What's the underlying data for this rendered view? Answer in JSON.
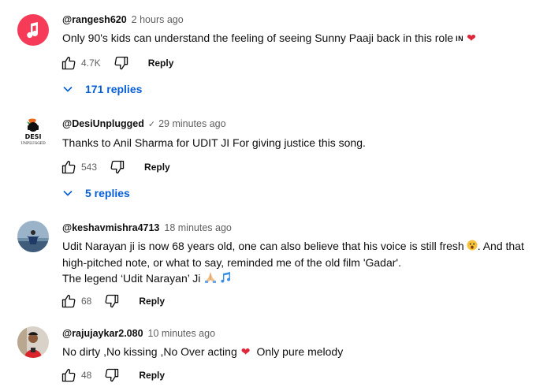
{
  "comments": [
    {
      "author": "@rangesh620",
      "time": "2 hours ago",
      "lines": [
        "Only 90's kids can understand the feeling of seeing Sunny Paaji back in this role"
      ],
      "country": "IN",
      "likes": "4.7K",
      "reply_label": "Reply",
      "replies_label": "171 replies",
      "avatar_icon": "music-note-icon",
      "avatar_color": "#f53b57"
    },
    {
      "author": "@DesiUnplugged",
      "verified": "✓",
      "time": "29 minutes ago",
      "lines": [
        "Thanks to Anil Sharma for UDIT JI For giving justice this song."
      ],
      "likes": "543",
      "reply_label": "Reply",
      "replies_label": "5 replies",
      "avatar_text_top": "DESI",
      "avatar_text_bottom": "UNPLUGGED"
    },
    {
      "author": "@keshavmishra4713",
      "time": "18 minutes ago",
      "lines": [
        "Udit Narayan ji is now 68 years old, one can also believe that his voice is still fresh",
        ". And that",
        "high-pitched note, or what to say, reminded me of the old film 'Gadar'.",
        "The legend ‘Udit Narayan’ Ji"
      ],
      "likes": "68",
      "reply_label": "Reply"
    },
    {
      "author": "@rajujaykar2.080",
      "time": "10 minutes ago",
      "lines": [
        "No dirty ,No kissing ,No Over acting",
        "Only pure melody"
      ],
      "likes": "48",
      "reply_label": "Reply"
    }
  ],
  "icons": {
    "like": "thumbs-up-icon",
    "dislike": "thumbs-down-icon",
    "expand": "chevron-down-icon",
    "heart": "heart-icon",
    "surprised": "surprised-face-emoji",
    "pray": "folded-hands-emoji",
    "music": "music-notes-emoji"
  },
  "colors": {
    "link": "#065fd4",
    "heart": "#e0263a",
    "muted": "#606060"
  }
}
